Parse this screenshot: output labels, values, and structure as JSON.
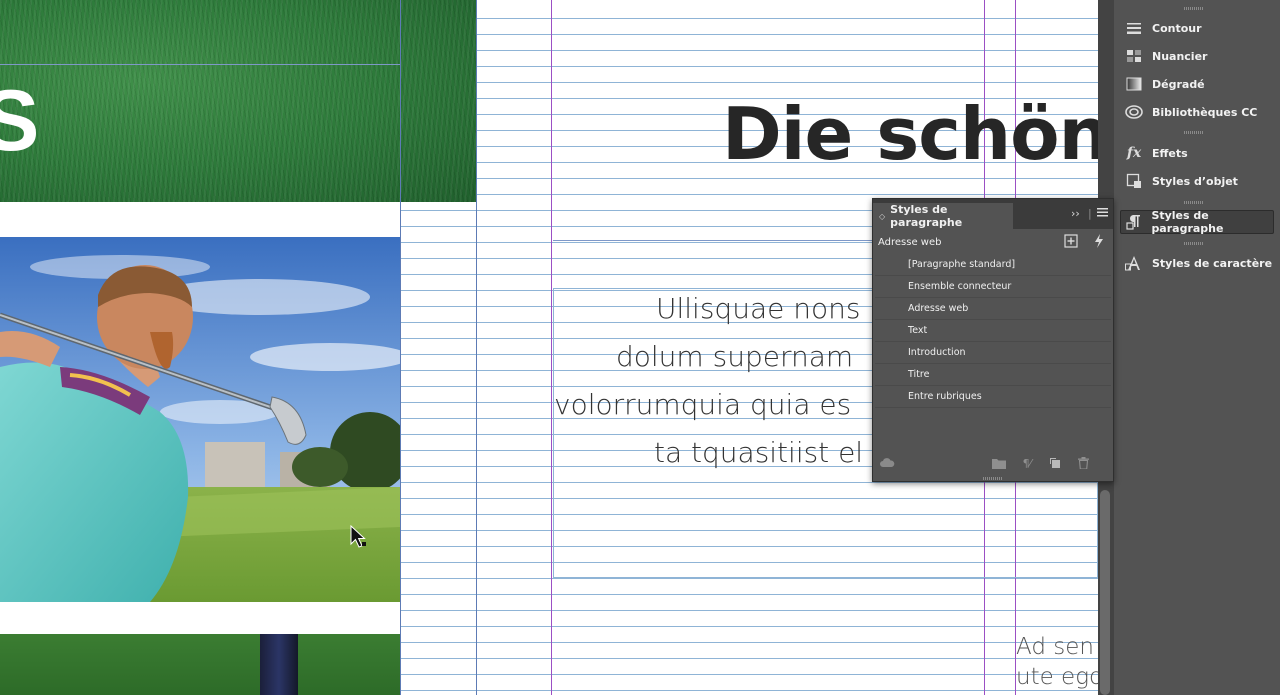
{
  "document": {
    "headline": "Die schön",
    "intro_lines": [
      "Ullisquae nons",
      "dolum supernam",
      "volorrumquia quia es",
      "ta tquasitiist el"
    ],
    "body_lines": [
      "Ad sen",
      "ute ego"
    ],
    "partial_letter": "S"
  },
  "dock": {
    "items": [
      {
        "label": "Contour",
        "icon": "stroke-icon"
      },
      {
        "label": "Nuancier",
        "icon": "swatches-icon"
      },
      {
        "label": "Dégradé",
        "icon": "gradient-icon"
      },
      {
        "label": "Bibliothèques CC",
        "icon": "cc-libraries-icon"
      },
      {
        "label": "Effets",
        "icon": "fx-icon"
      },
      {
        "label": "Styles d’objet",
        "icon": "object-styles-icon"
      },
      {
        "label": "Styles de paragraphe",
        "icon": "paragraph-styles-icon",
        "active": true
      },
      {
        "label": "Styles de caractère",
        "icon": "character-styles-icon"
      }
    ]
  },
  "paragraph_panel": {
    "tab_title": "Styles de paragraphe",
    "current_style": "Adresse web",
    "styles": [
      "[Paragraphe standard]",
      "Ensemble connecteur",
      "Adresse web",
      "Text",
      "Introduction",
      "Titre",
      "Entre rubriques"
    ]
  },
  "colors": {
    "panel_bg": "#535353",
    "guide_purple": "#9b4fc4",
    "baseline_blue": "#8fb4d6"
  }
}
